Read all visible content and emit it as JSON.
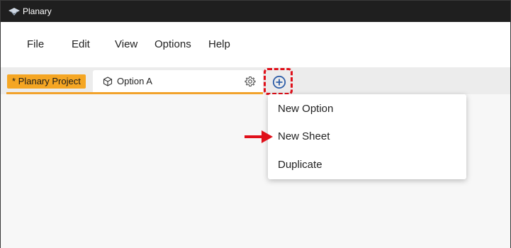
{
  "window": {
    "title": "Planary"
  },
  "menu": {
    "items": [
      "File",
      "Edit",
      "View",
      "Options",
      "Help"
    ]
  },
  "tabs": {
    "project_label": "* Planary Project",
    "option_label": "Option A"
  },
  "dropdown": {
    "items": [
      "New Option",
      "New Sheet",
      "Duplicate"
    ]
  },
  "colors": {
    "titlebar": "#1f1f1f",
    "accent": "#f5a623",
    "highlight": "#e0101a",
    "add_icon": "#2f5fa8"
  },
  "icons": {
    "app": "eye-logo-icon",
    "option_tab": "cube-icon",
    "settings": "gear-icon",
    "add": "plus-circle-icon",
    "annotation": "red-arrow-icon"
  }
}
